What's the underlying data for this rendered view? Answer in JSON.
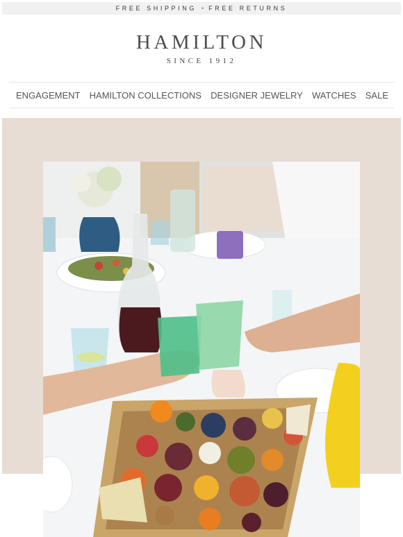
{
  "topbar": {
    "left": "FREE SHIPPING",
    "separator": "•",
    "right": "FREE RETURNS"
  },
  "brand": {
    "name": "HAMILTON",
    "tagline": "SINCE 1912"
  },
  "nav": {
    "items": [
      {
        "label": "ENGAGEMENT"
      },
      {
        "label": "HAMILTON COLLECTIONS"
      },
      {
        "label": "DESIGNER JEWELRY"
      },
      {
        "label": "WATCHES"
      },
      {
        "label": "SALE"
      }
    ]
  },
  "colors": {
    "topbar_bg": "#f1f1f1",
    "hero_bg": "#e8ddd5",
    "text": "#555555"
  }
}
